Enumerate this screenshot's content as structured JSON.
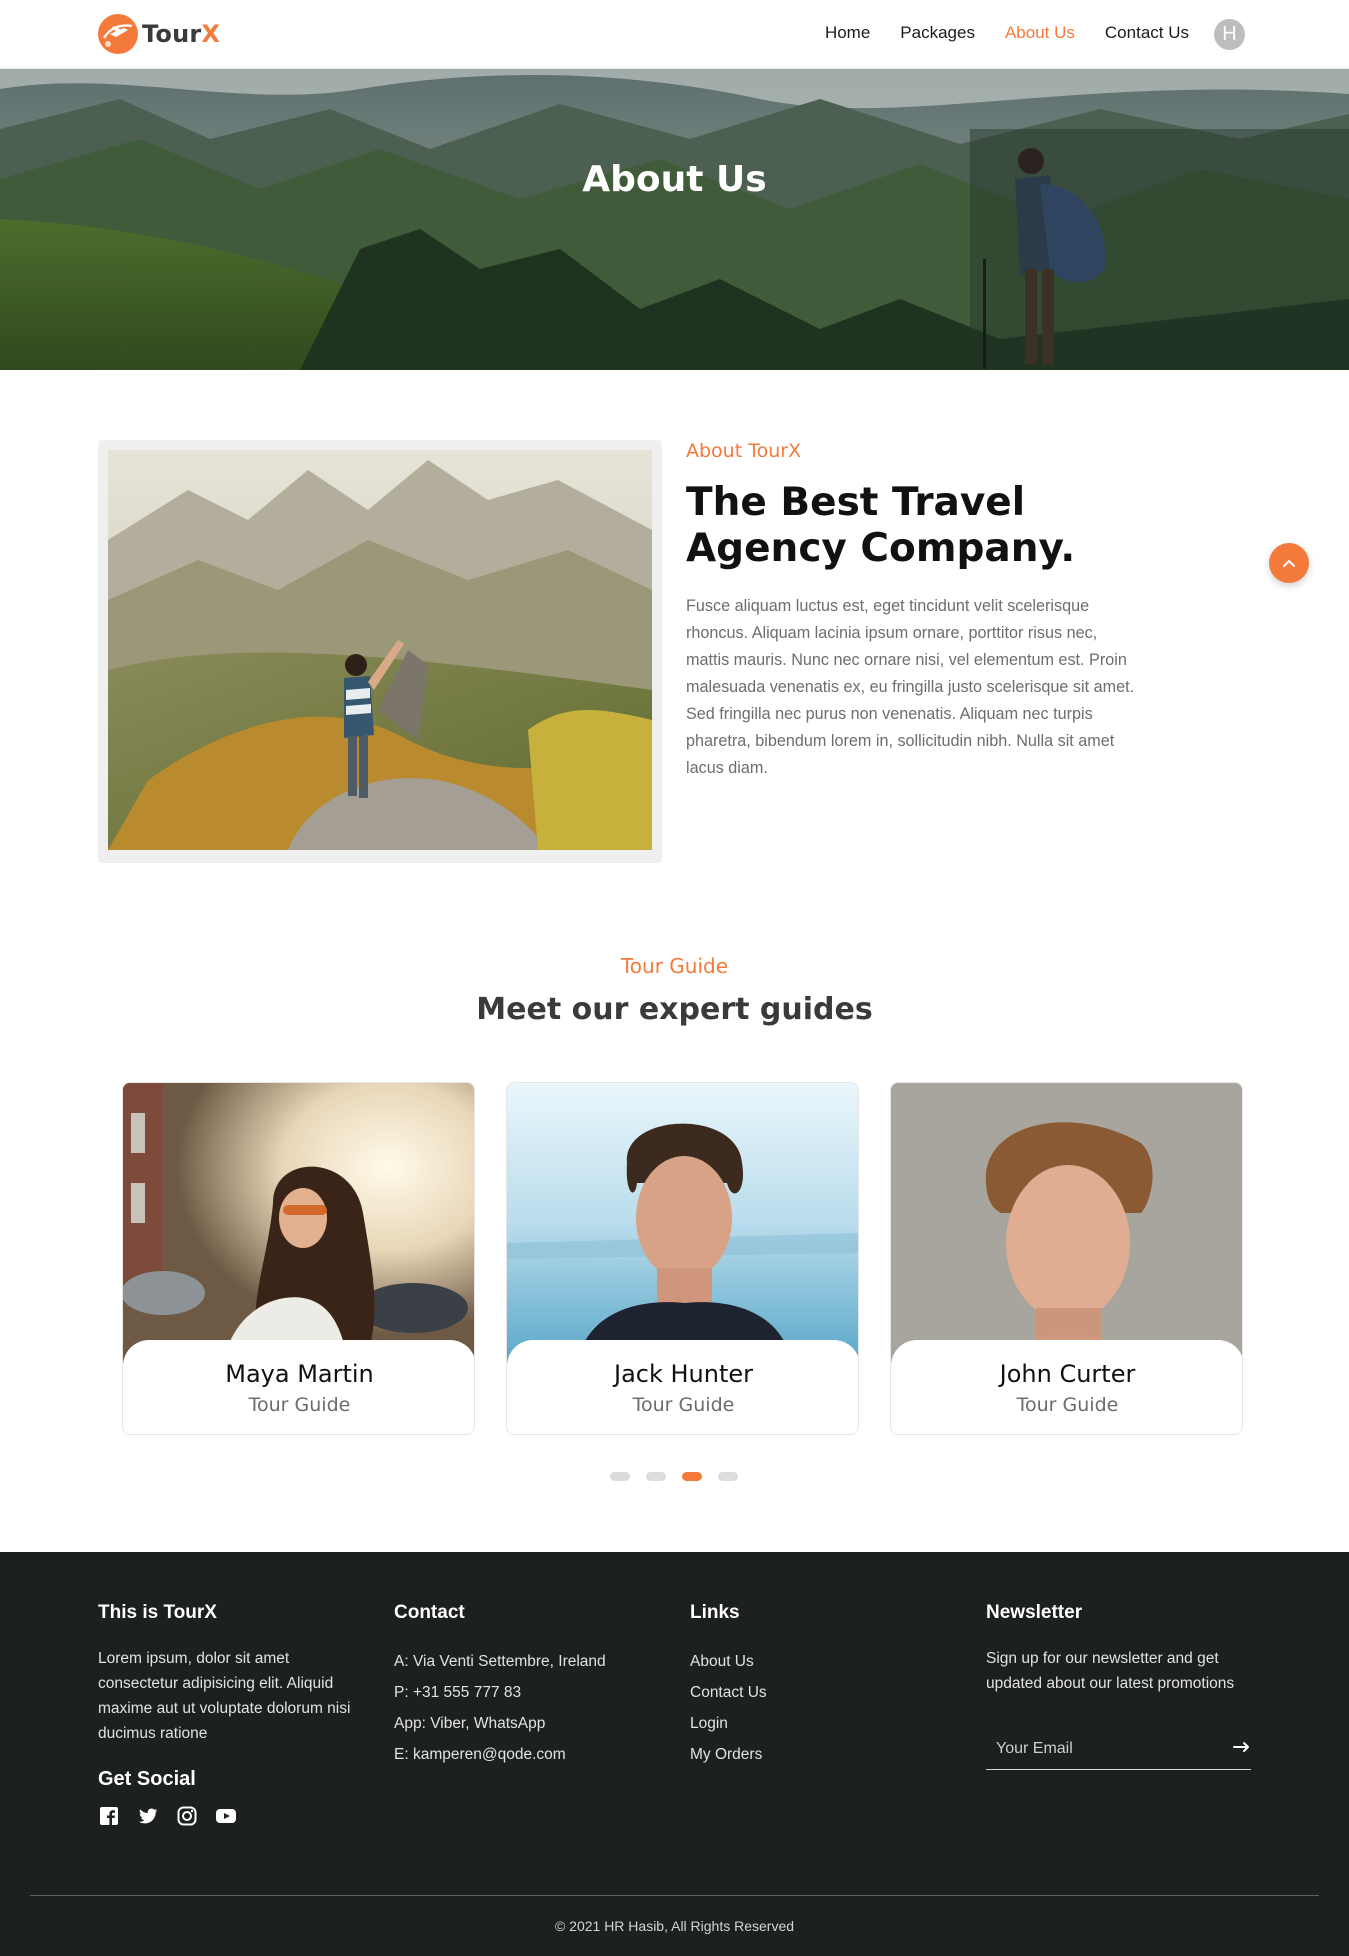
{
  "brand": {
    "name_main": "Tour",
    "name_accent": "X",
    "accent_color": "#f47a3c"
  },
  "nav": {
    "items": [
      {
        "label": "Home",
        "active": false
      },
      {
        "label": "Packages",
        "active": false
      },
      {
        "label": "About Us",
        "active": true
      },
      {
        "label": "Contact Us",
        "active": false
      }
    ],
    "avatar_initial": "H"
  },
  "hero": {
    "title": "About Us"
  },
  "about": {
    "kicker": "About TourX",
    "title": "The Best Travel Agency Company.",
    "text": "Fusce aliquam luctus est, eget tincidunt velit scelerisque rhoncus. Aliquam lacinia ipsum ornare, porttitor risus nec, mattis mauris. Nunc nec ornare nisi, vel elementum est. Proin malesuada venenatis ex, eu fringilla justo scelerisque sit amet. Sed fringilla nec purus non venenatis. Aliquam nec turpis pharetra, bibendum lorem in, sollicitudin nibh. Nulla sit amet lacus diam."
  },
  "guides": {
    "kicker": "Tour Guide",
    "title": "Meet our expert guides",
    "cards": [
      {
        "name": "Maya Martin",
        "role": "Tour Guide"
      },
      {
        "name": "Jack Hunter",
        "role": "Tour Guide"
      },
      {
        "name": "John Curter",
        "role": "Tour Guide"
      }
    ],
    "slider_dots": 4,
    "active_dot": 3
  },
  "footer": {
    "about": {
      "title": "This is TourX",
      "text": "Lorem ipsum, dolor sit amet consectetur adipisicing elit. Aliquid maxime aut ut voluptate dolorum nisi ducimus ratione"
    },
    "social_title": "Get Social",
    "social_icons": [
      "facebook-icon",
      "twitter-icon",
      "instagram-icon",
      "youtube-icon"
    ],
    "contact": {
      "title": "Contact",
      "lines": [
        "A: Via Venti Settembre, Ireland",
        "P: +31 555 777 83",
        "App: Viber, WhatsApp",
        "E: kamperen@qode.com"
      ]
    },
    "links": {
      "title": "Links",
      "items": [
        "About Us",
        "Contact Us",
        "Login",
        "My Orders"
      ]
    },
    "newsletter": {
      "title": "Newsletter",
      "text": "Sign up for our newsletter and get updated about our latest promotions",
      "email_placeholder": "Your Email"
    },
    "copyright": "© 2021 HR Hasib, All Rights Reserved"
  }
}
